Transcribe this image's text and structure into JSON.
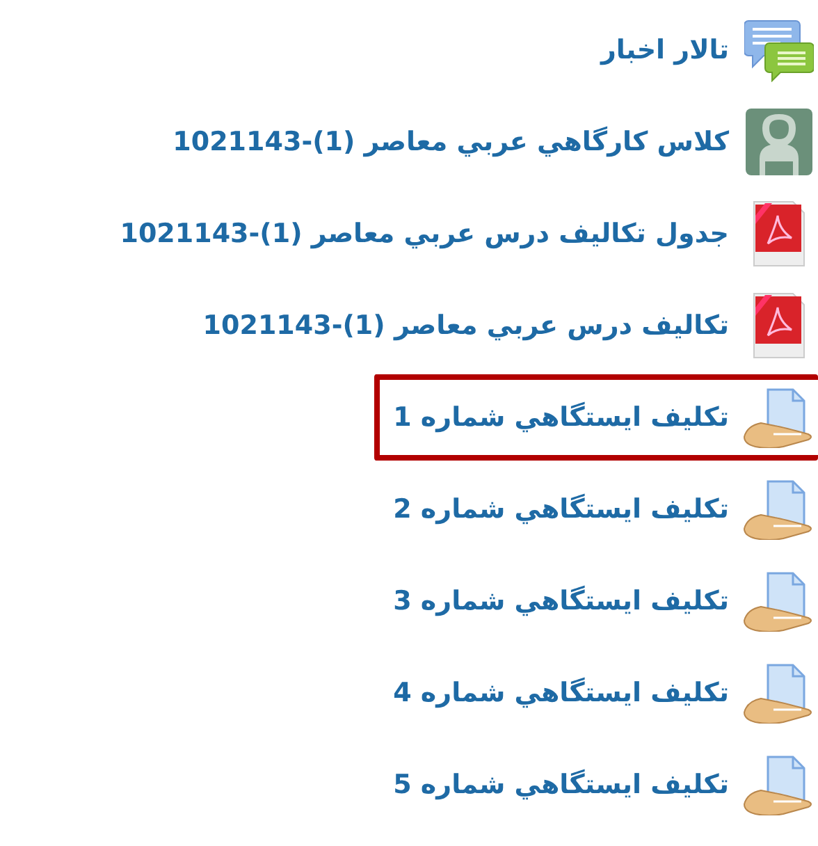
{
  "items": [
    {
      "kind": "forum",
      "label": "تالار اخبار",
      "highlighted": false
    },
    {
      "kind": "chat",
      "label": "كلاس كارگاهي عربي معاصر (1)-1021143",
      "highlighted": false
    },
    {
      "kind": "pdf",
      "label": "جدول تكاليف درس عربي معاصر (1)-1021143",
      "highlighted": false
    },
    {
      "kind": "pdf",
      "label": "تكاليف درس عربي معاصر (1)-1021143",
      "highlighted": false
    },
    {
      "kind": "assignment",
      "label": "تكليف ايستگاهي شماره 1",
      "highlighted": true
    },
    {
      "kind": "assignment",
      "label": "تكليف ايستگاهي شماره 2",
      "highlighted": false
    },
    {
      "kind": "assignment",
      "label": "تكليف ايستگاهي شماره 3",
      "highlighted": false
    },
    {
      "kind": "assignment",
      "label": "تكليف ايستگاهي شماره 4",
      "highlighted": false
    },
    {
      "kind": "assignment",
      "label": "تكليف ايستگاهي شماره 5",
      "highlighted": false
    }
  ]
}
